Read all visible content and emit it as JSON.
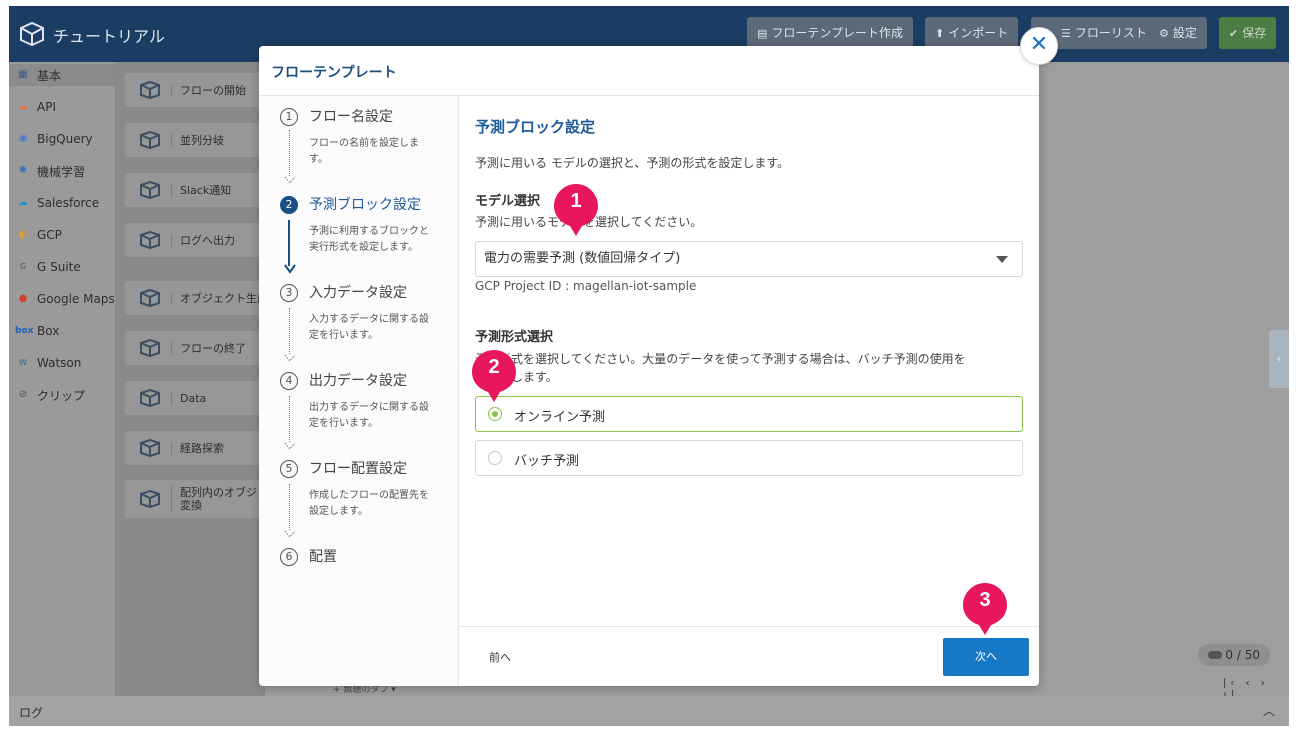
{
  "app": {
    "title": "チュートリアル",
    "toolbar": [
      {
        "icon": "document-icon",
        "glyph": "▤",
        "label": "フローテンプレート作成"
      },
      {
        "icon": "upload-icon",
        "glyph": "⬆",
        "label": "インポート"
      },
      {
        "icon": "list-icon",
        "glyph": "☰",
        "label": "フローリスト"
      },
      {
        "icon": "gear-icon",
        "glyph": "⚙",
        "label": "設定"
      },
      {
        "icon": "check-circle-icon",
        "glyph": "✔",
        "label": "保存"
      }
    ],
    "categories": [
      {
        "label": "基本",
        "glyph": "▦",
        "color": "#3b5f86"
      },
      {
        "label": "API",
        "glyph": "☁",
        "color": "#e07050"
      },
      {
        "label": "BigQuery",
        "glyph": "◉",
        "color": "#4a78d0"
      },
      {
        "label": "機械学習",
        "glyph": "✺",
        "color": "#3b6fc0"
      },
      {
        "label": "Salesforce",
        "glyph": "☁",
        "color": "#2b90d0"
      },
      {
        "label": "GCP",
        "glyph": "◐",
        "color": "#e0a030"
      },
      {
        "label": "G Suite",
        "glyph": "G",
        "color": "#555555"
      },
      {
        "label": "Google Maps",
        "glyph": "●",
        "color": "#d04030"
      },
      {
        "label": "Box",
        "glyph": "box",
        "color": "#2060b0"
      },
      {
        "label": "Watson",
        "glyph": "W",
        "color": "#2a6a9a"
      },
      {
        "label": "クリップ",
        "glyph": "⊘",
        "color": "#555555"
      }
    ],
    "blocks": [
      "フローの開始",
      "並列分岐",
      "Slack通知",
      "ログへ出力",
      "オブジェクト生成",
      "フローの終了",
      "Data",
      "経路探索",
      "配列内のオブジェ\n変換"
    ],
    "log_label": "ログ",
    "counter": "0 / 50",
    "pager": "|‹ ‹ › ›|",
    "tab_strip": "+    無題のタブ ▾"
  },
  "modal": {
    "title": "フローテンプレート",
    "close_glyph": "✕",
    "steps": [
      {
        "num": "1",
        "title": "フロー名設定",
        "desc": "フローの名前を設定しま\nす。"
      },
      {
        "num": "2",
        "title": "予測ブロック設定",
        "desc": "予測に利用するブロックと\n実行形式を設定します。"
      },
      {
        "num": "3",
        "title": "入力データ設定",
        "desc": "入力するデータに関する設\n定を行います。"
      },
      {
        "num": "4",
        "title": "出力データ設定",
        "desc": "出力するデータに関する設\n定を行います。"
      },
      {
        "num": "5",
        "title": "フロー配置設定",
        "desc": "作成したフローの配置先を\n設定します。"
      },
      {
        "num": "6",
        "title": "配置",
        "desc": ""
      }
    ],
    "active_step": 2,
    "section_title": "予測ブロック設定",
    "section_desc": "予測に用いる モデルの選択と、予測の形式を設定します。",
    "model_heading": "モデル選択",
    "model_desc": "予測に用いるモデルを選択してください。",
    "model_selected": "電力の需要予測 (数値回帰タイプ)",
    "project_id": "GCP Project ID :  magellan-iot-sample",
    "format_heading": "予測形式選択",
    "format_desc": "予測形式を選択してください。大量のデータを使って予測する場合は、バッチ予測の使用を\nお勧めします。",
    "options": [
      {
        "label": "オンライン予測",
        "selected": true
      },
      {
        "label": "バッチ予測",
        "selected": false
      }
    ],
    "prev_label": "前へ",
    "next_label": "次へ"
  },
  "markers": [
    "1",
    "2",
    "3"
  ],
  "colors": {
    "marker": "#e8175d",
    "accent": "#1778c6",
    "selected": "#8bc34a"
  }
}
